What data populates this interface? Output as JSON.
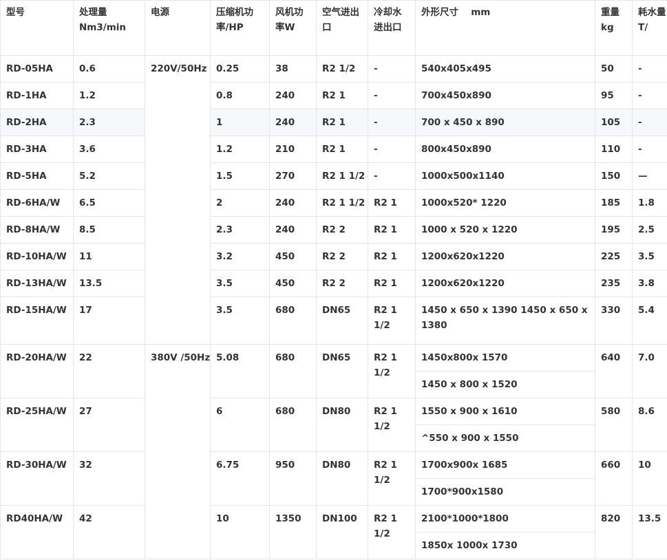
{
  "headers": {
    "model": "型号",
    "capacity": "处理量 Nm3/min",
    "power": "电源",
    "compressor": "压缩机功率/HP",
    "fan": "风机功率W",
    "air_io": "空气进出口",
    "water_io": "冷却水 进出口",
    "dims": "外形尺寸　 mm",
    "weight": "重量 kg",
    "consumption": "耗水量 T/"
  },
  "power_groups": [
    "220V/50Hz",
    "380V /50Hz"
  ],
  "rows": [
    {
      "model": "RD-05HA",
      "capacity": "0.6",
      "compressor": "0.25",
      "fan": "38",
      "air": "R2 1/2",
      "water": "-",
      "dims": [
        "540x405x495"
      ],
      "weight": "50",
      "consumption": "-"
    },
    {
      "model": "RD-1HA",
      "capacity": "1.2",
      "compressor": "0.8",
      "fan": "240",
      "air": "R2 1",
      "water": "-",
      "dims": [
        "700x450x890"
      ],
      "weight": "95",
      "consumption": "-"
    },
    {
      "model": "RD-2HA",
      "capacity": "2.3",
      "compressor": "1",
      "fan": "240",
      "air": "R2 1",
      "water": "-",
      "dims": [
        "700 x 450 x 890"
      ],
      "weight": "105",
      "consumption": "-"
    },
    {
      "model": "RD-3HA",
      "capacity": "3.6",
      "compressor": "1.2",
      "fan": "210",
      "air": "R2 1",
      "water": "-",
      "dims": [
        "800x450x890"
      ],
      "weight": "110",
      "consumption": "-"
    },
    {
      "model": "RD-5HA",
      "capacity": "5.2",
      "compressor": "1.5",
      "fan": "270",
      "air": "R2 1 1/2",
      "water": "-",
      "dims": [
        "1000x500x1140"
      ],
      "weight": "150",
      "consumption": "—"
    },
    {
      "model": "RD-6HA/W",
      "capacity": "6.5",
      "compressor": "2",
      "fan": "240",
      "air": "R2 1 1/2",
      "water": "R2 1",
      "dims": [
        "1000x520* 1220"
      ],
      "weight": "185",
      "consumption": "1.8"
    },
    {
      "model": "RD-8HA/W",
      "capacity": "8.5",
      "compressor": "2.3",
      "fan": "240",
      "air": "R2 2",
      "water": "R2 1",
      "dims": [
        "1000 x 520 x 1220"
      ],
      "weight": "195",
      "consumption": "2.5"
    },
    {
      "model": "RD-10HA/W",
      "capacity": "11",
      "compressor": "3.2",
      "fan": "450",
      "air": "R2 2",
      "water": "R2 1",
      "dims": [
        "1200x620x1220"
      ],
      "weight": "225",
      "consumption": "3.5"
    },
    {
      "model": "RD-13HA/W",
      "capacity": "13.5",
      "compressor": "3.5",
      "fan": "450",
      "air": "R2 2",
      "water": "R2 1",
      "dims": [
        "1200x620x1220"
      ],
      "weight": "235",
      "consumption": "3.8"
    },
    {
      "model": "RD-15HA/W",
      "capacity": "17",
      "compressor": "3.5",
      "fan": "680",
      "air": "DN65",
      "water": "R2 1 1/2",
      "dims": [
        "1450 x 650 x 1390 1450 x 650 x 1380"
      ],
      "weight": "330",
      "consumption": "5.4"
    },
    {
      "model": "RD-20HA/W",
      "capacity": "22",
      "compressor": "5.08",
      "fan": "680",
      "air": "DN65",
      "water": "R2 1 1/2",
      "dims": [
        "1450x800x 1570",
        "1450 x 800 x 1520"
      ],
      "weight": "640",
      "consumption": "7.0"
    },
    {
      "model": "RD-25HA/W",
      "capacity": "27",
      "compressor": "6",
      "fan": "680",
      "air": "DN80",
      "water": "R2 1 1/2",
      "dims": [
        "1550 x 900 x 1610",
        "^550 x 900 x 1550"
      ],
      "weight": "580",
      "consumption": "8.6"
    },
    {
      "model": "RD-30HA/W",
      "capacity": "32",
      "compressor": "6.75",
      "fan": "950",
      "air": "DN80",
      "water": "R2 1 1/2",
      "dims": [
        "1700x900x 1685",
        "1700*900x1580"
      ],
      "weight": "660",
      "consumption": "10"
    },
    {
      "model": "RD40HA/W",
      "capacity": "42",
      "compressor": "10",
      "fan": "1350",
      "air": "DN100",
      "water": "R2 1 1/2",
      "dims": [
        "2100*1000*1800",
        "1850x 1000x 1730"
      ],
      "weight": "820",
      "consumption": "13.5"
    }
  ]
}
